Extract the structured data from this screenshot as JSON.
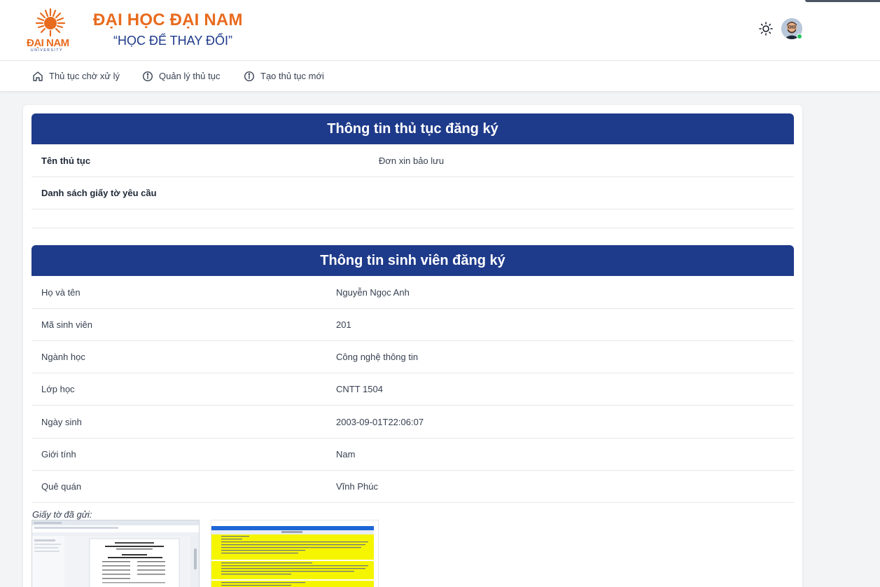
{
  "brand": {
    "logo_word": "ĐẠI NAM",
    "logo_sub": "UNIVERSITY",
    "title": "ĐẠI HỌC ĐẠI NAM",
    "slogan": "“HỌC ĐỂ THAY ĐỔI”"
  },
  "nav": {
    "items": [
      {
        "label": "Thủ tục chờ xử lý",
        "icon": "home-icon"
      },
      {
        "label": "Quản lý thủ tục",
        "icon": "info-icon"
      },
      {
        "label": "Tạo thủ tục mới",
        "icon": "info-icon"
      }
    ]
  },
  "procedure": {
    "title": "Thông tin thủ tục đăng ký",
    "name_label": "Tên thủ tục",
    "name_value": "Đơn xin bảo lưu",
    "docs_label": "Danh sách giấy tờ yêu cầu"
  },
  "student": {
    "title": "Thông tin sinh viên đăng ký",
    "rows": [
      {
        "label": "Họ và tên",
        "value": "Nguyễn Ngọc Anh"
      },
      {
        "label": "Mã sinh viên",
        "value": "201"
      },
      {
        "label": "Ngành học",
        "value": "Công nghệ thông tin"
      },
      {
        "label": "Lớp học",
        "value": "CNTT 1504"
      },
      {
        "label": "Ngày sinh",
        "value": "2003-09-01T22:06:07"
      },
      {
        "label": "Giới tính",
        "value": "Nam"
      },
      {
        "label": "Quê quán",
        "value": "Vĩnh Phúc"
      }
    ]
  },
  "submitted": {
    "label": "Giấy tờ đã gửi:"
  },
  "colors": {
    "primary": "#1e3a8a",
    "brand_orange": "#e86b1e",
    "online": "#22c55e"
  }
}
